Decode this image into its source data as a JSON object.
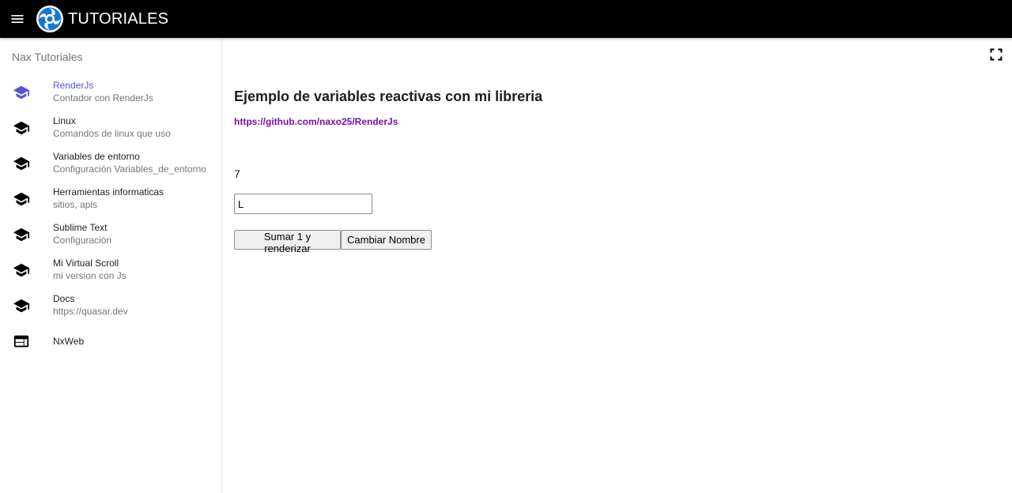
{
  "header": {
    "title": "TUTORIALES",
    "menu_icon": "menu-icon",
    "logo_icon": "quasar-logo-icon",
    "background": "#000000"
  },
  "drawer": {
    "header": "Nax Tutoriales",
    "active_color": "#5753d9",
    "items": [
      {
        "label": "RenderJs",
        "caption": "Contador con RenderJs",
        "icon": "school-icon",
        "active": true
      },
      {
        "label": "Linux",
        "caption": "Comandos de linux que uso",
        "icon": "school-icon"
      },
      {
        "label": "Variables de entorno",
        "caption": "Configuración Variables_de_entorno",
        "icon": "school-icon"
      },
      {
        "label": "Herramientas informaticas",
        "caption": "sitios, apis",
        "icon": "school-icon"
      },
      {
        "label": "Sublime Text",
        "caption": "Configuración",
        "icon": "school-icon"
      },
      {
        "label": "Mi Virtual Scroll",
        "caption": "mi version con Js",
        "icon": "school-icon"
      },
      {
        "label": "Docs",
        "caption": "https://quasar.dev",
        "icon": "school-icon"
      },
      {
        "label": "NxWeb",
        "icon": "web-icon"
      }
    ]
  },
  "main": {
    "title": "Ejemplo de variables reactivas con mi libreria",
    "link": "https://github.com/naxo25/RenderJs",
    "link_color": "#7b0fa8",
    "counter": "7",
    "name_input_value": "L",
    "sum_button": "Sumar 1 y renderizar",
    "name_button": "Cambiar Nombre",
    "fullscreen_icon": "fullscreen-icon"
  }
}
